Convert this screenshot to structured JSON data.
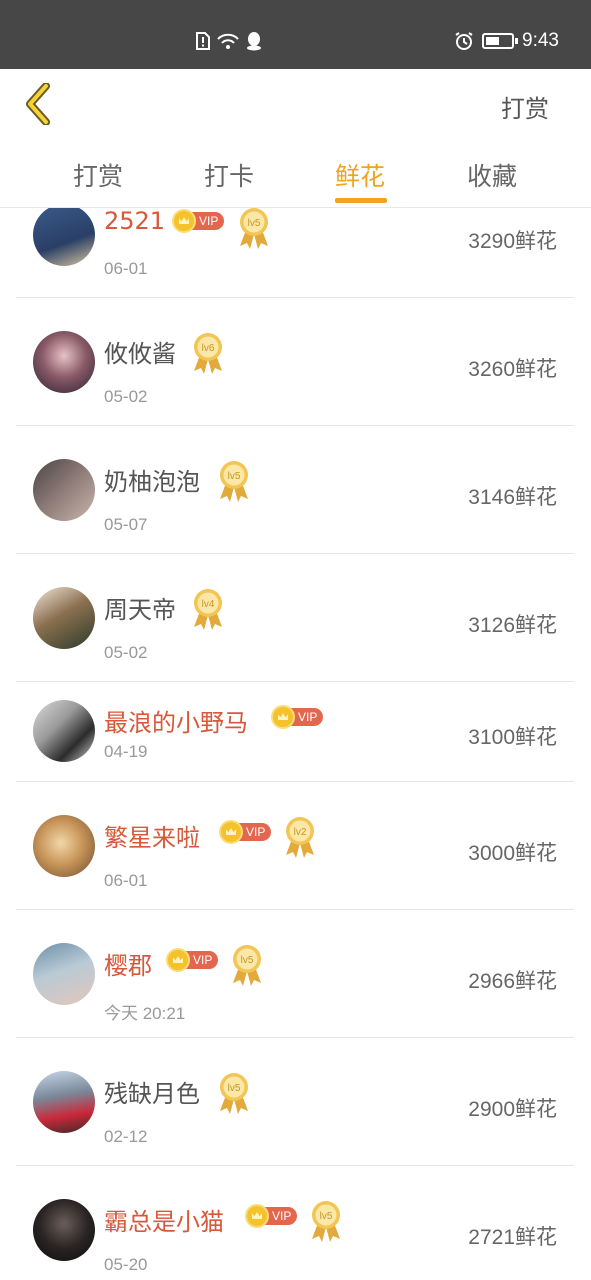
{
  "status_bar": {
    "time": "9:43",
    "battery_level": 0.55
  },
  "header": {
    "action_label": "打赏"
  },
  "tabs": [
    {
      "label": "打赏",
      "active": false
    },
    {
      "label": "打卡",
      "active": false
    },
    {
      "label": "鲜花",
      "active": true
    },
    {
      "label": "收藏",
      "active": false
    }
  ],
  "colors": {
    "accent": "#f0a41e",
    "vip_name": "#d9573a",
    "status_bar": "#474747"
  },
  "entries": [
    {
      "name": "2521",
      "vip": true,
      "level": "lv5",
      "date": "06-01",
      "count": "3290鲜花"
    },
    {
      "name": "攸攸酱",
      "vip": false,
      "level": "lv6",
      "date": "05-02",
      "count": "3260鲜花"
    },
    {
      "name": "奶柚泡泡",
      "vip": false,
      "level": "lv5",
      "date": "05-07",
      "count": "3146鲜花"
    },
    {
      "name": "周天帝",
      "vip": false,
      "level": "lv4",
      "date": "05-02",
      "count": "3126鲜花"
    },
    {
      "name": "最浪的小野马",
      "vip": true,
      "level": "",
      "date": "04-19",
      "count": "3100鲜花"
    },
    {
      "name": "繁星来啦",
      "vip": true,
      "level": "lv2",
      "date": "06-01",
      "count": "3000鲜花"
    },
    {
      "name": "樱郡",
      "vip": true,
      "level": "lv5",
      "date": "今天 20:21",
      "count": "2966鲜花"
    },
    {
      "name": "残缺月色",
      "vip": false,
      "level": "lv5",
      "date": "02-12",
      "count": "2900鲜花"
    },
    {
      "name": "霸总是小猫",
      "vip": true,
      "level": "lv5",
      "date": "05-20",
      "count": "2721鲜花"
    }
  ],
  "vip_label": "VIP"
}
